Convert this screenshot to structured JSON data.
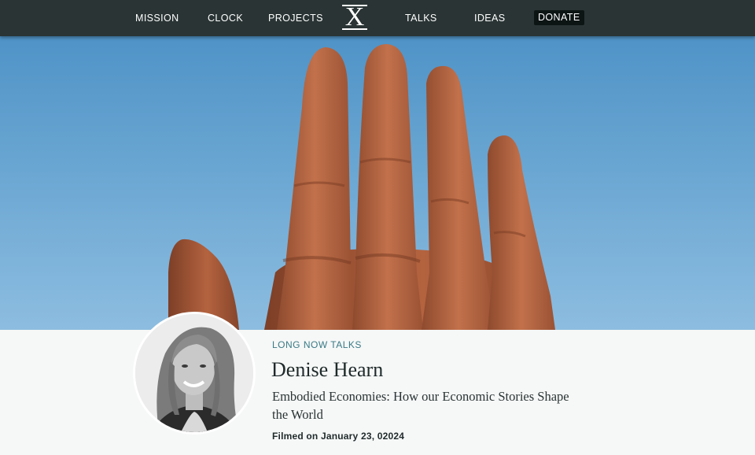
{
  "nav": {
    "items": [
      "MISSION",
      "CLOCK",
      "PROJECTS",
      "TALKS",
      "IDEAS"
    ],
    "logo_letter": "X",
    "donate_label": "DONATE"
  },
  "talk": {
    "series": "LONG NOW TALKS",
    "speaker": "Denise Hearn",
    "title": "Embodied Economies: How our Economic Stories Shape the World",
    "filmed": "Filmed on January 23, 02024"
  },
  "colors": {
    "nav_bg": "#2a3434",
    "accent": "#3a7a86",
    "sky": "#6aa6d2",
    "stone": "#b0603d"
  },
  "icons": [
    "long-now-logo-icon"
  ]
}
